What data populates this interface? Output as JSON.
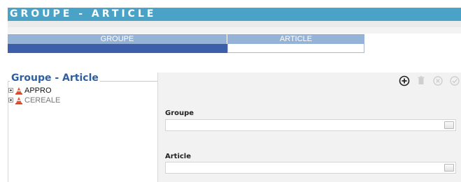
{
  "page": {
    "title": "GROUPE - ARTICLE"
  },
  "tabs": [
    {
      "label": "GROUPE",
      "active": true
    },
    {
      "label": "ARTICLE",
      "active": false
    }
  ],
  "tree_panel": {
    "legend": "Groupe - Article",
    "items": [
      {
        "label": "APPRO",
        "icon": "cone-icon"
      },
      {
        "label": "CEREALE",
        "icon": "cone-icon"
      }
    ]
  },
  "form": {
    "fields": [
      {
        "label": "Groupe",
        "value": ""
      },
      {
        "label": "Article",
        "value": ""
      }
    ]
  },
  "toolbar": {
    "icons": [
      "add-icon",
      "delete-icon",
      "cancel-icon",
      "validate-icon"
    ]
  },
  "colors": {
    "title_bar": "#4aa3c7",
    "tab_header": "#95b3d7",
    "tab_active_body": "#3d5ea8",
    "legend_text": "#2e5fa3"
  }
}
